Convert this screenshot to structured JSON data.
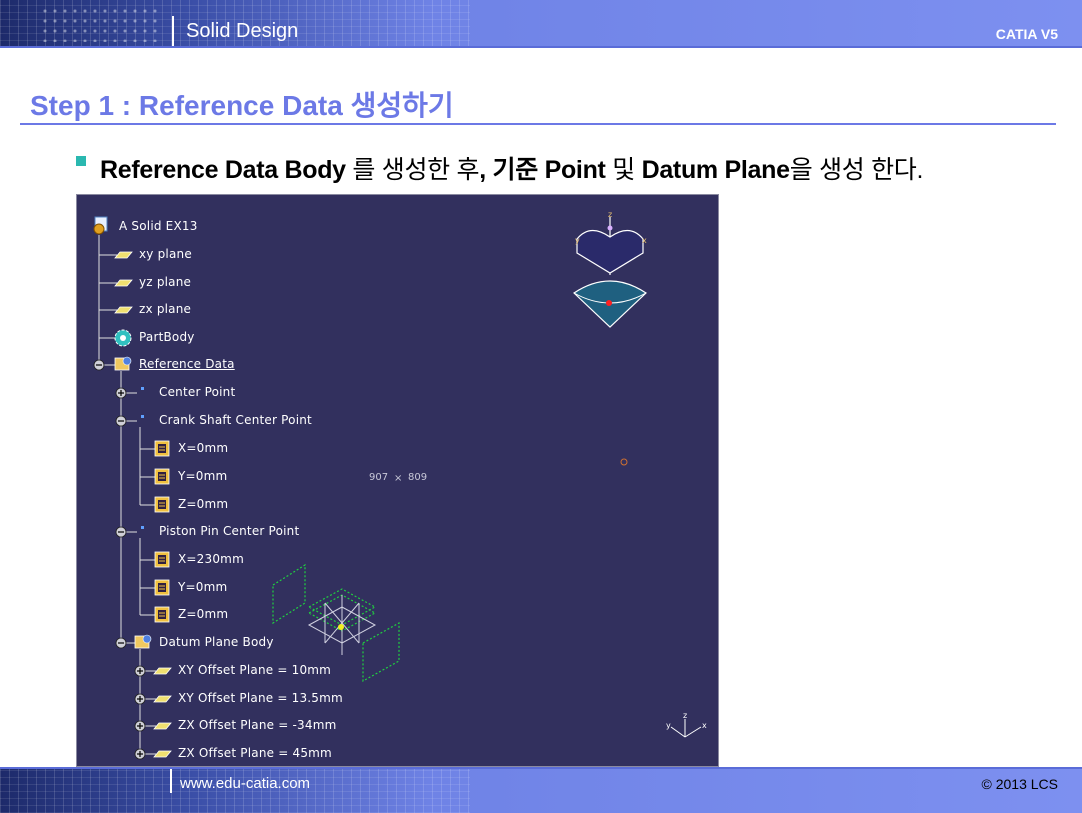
{
  "header": {
    "title": "Solid Design",
    "brand": "CATIA V5"
  },
  "slide": {
    "title": "Step 1 : Reference Data 생성하기",
    "bullet": {
      "part1": "Reference Data Body",
      "part2": " 를 생성한 후",
      "part3": ", 기준 ",
      "part4": "Point",
      "part5": " 및 ",
      "part6": "Datum Plane",
      "part7": "을 생성 한다."
    }
  },
  "viewport": {
    "background": "#32305e",
    "tree": [
      {
        "label": "A Solid EX13",
        "icon": "part-icon"
      },
      {
        "label": "xy plane",
        "icon": "plane-icon"
      },
      {
        "label": "yz plane",
        "icon": "plane-icon"
      },
      {
        "label": "zx plane",
        "icon": "plane-icon"
      },
      {
        "label": "PartBody",
        "icon": "gear-body-icon"
      },
      {
        "label": "Reference Data",
        "icon": "geometric-set-icon"
      },
      {
        "label": "Center Point",
        "icon": "point-icon"
      },
      {
        "label": "Crank Shaft Center Point",
        "icon": "point-icon"
      },
      {
        "label": "X=0mm",
        "icon": "parameter-icon"
      },
      {
        "label": "Y=0mm",
        "icon": "parameter-icon"
      },
      {
        "label": "Z=0mm",
        "icon": "parameter-icon"
      },
      {
        "label": "Piston Pin Center Point",
        "icon": "point-icon"
      },
      {
        "label": "X=230mm",
        "icon": "parameter-icon"
      },
      {
        "label": "Y=0mm",
        "icon": "parameter-icon"
      },
      {
        "label": "Z=0mm",
        "icon": "parameter-icon"
      },
      {
        "label": "Datum Plane Body",
        "icon": "geometric-set-icon"
      },
      {
        "label": "XY Offset Plane = 10mm",
        "icon": "plane-icon"
      },
      {
        "label": "XY Offset Plane = 13.5mm",
        "icon": "plane-icon"
      },
      {
        "label": "ZX Offset Plane = -34mm",
        "icon": "plane-icon"
      },
      {
        "label": "ZX Offset Plane = 45mm",
        "icon": "plane-icon"
      }
    ],
    "coords": {
      "x": "907",
      "sep": "×",
      "y": "809"
    },
    "compass": {
      "z_label": "z",
      "y_label": "y",
      "x_label": "x"
    },
    "axis": {
      "z_label": "z",
      "y_label": "y",
      "x_label": "x"
    }
  },
  "footer": {
    "url": "www.edu-catia.com",
    "copyright": "© 2013 LCS"
  }
}
